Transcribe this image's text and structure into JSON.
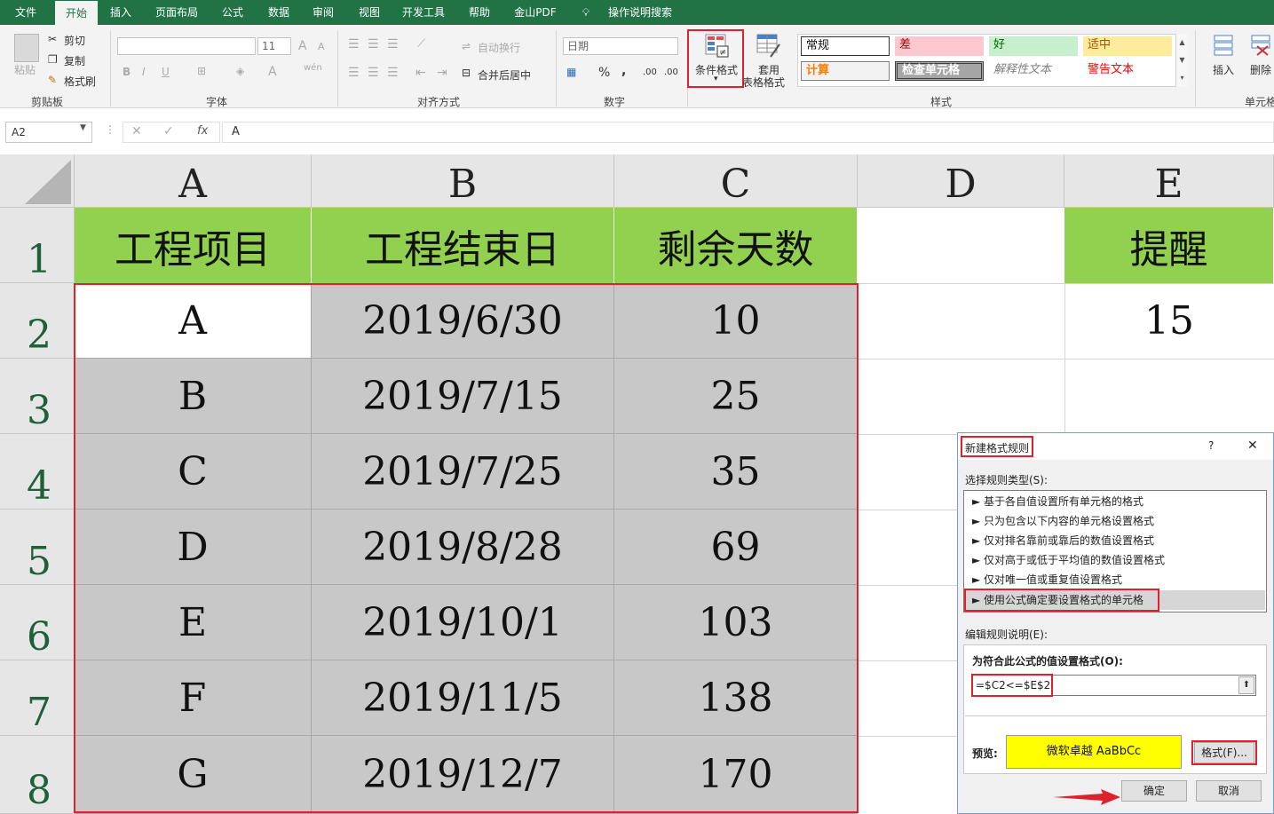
{
  "menu": {
    "items": [
      "文件",
      "开始",
      "插入",
      "页面布局",
      "公式",
      "数据",
      "审阅",
      "视图",
      "开发工具",
      "帮助",
      "金山PDF",
      "操作说明搜索"
    ],
    "active": "开始"
  },
  "ribbon": {
    "clipboard": {
      "paste": "粘贴",
      "cut": "剪切",
      "copy": "复制",
      "format_painter": "格式刷",
      "label": "剪贴板"
    },
    "font": {
      "font_size": "11",
      "bold": "B",
      "italic": "I",
      "underline": "U",
      "label": "字体",
      "grow": "A",
      "shrink": "A",
      "color_a": "A",
      "wen": "wén"
    },
    "alignment": {
      "wrap": "自动换行",
      "merge": "合并后居中",
      "label": "对齐方式"
    },
    "number": {
      "format": "日期",
      "percent": "%",
      "comma": ",",
      "inc_dec": ".00",
      "label": "数字"
    },
    "styles": {
      "conditional": "条件格式",
      "table_format_1": "套用",
      "table_format_2": "表格格式",
      "normal": "常规",
      "bad": "差",
      "good": "好",
      "neutral": "适中",
      "calc": "计算",
      "check": "检查单元格",
      "explain": "解释性文本",
      "warn": "警告文本",
      "label": "样式"
    },
    "cells": {
      "insert": "插入",
      "delete": "删除",
      "label": "单元格"
    }
  },
  "formula_bar": {
    "name_box": "A2",
    "fx": "fx",
    "value": "A"
  },
  "sheet": {
    "columns": [
      "A",
      "B",
      "C",
      "D",
      "E"
    ],
    "rows": [
      "1",
      "2",
      "3",
      "4",
      "5",
      "6",
      "7",
      "8"
    ],
    "headers": [
      "工程项目",
      "工程结束日",
      "剩余天数"
    ],
    "reminder_header": "提醒",
    "reminder_value": "15",
    "data": [
      [
        "A",
        "2019/6/30",
        "10"
      ],
      [
        "B",
        "2019/7/15",
        "25"
      ],
      [
        "C",
        "2019/7/25",
        "35"
      ],
      [
        "D",
        "2019/8/28",
        "69"
      ],
      [
        "E",
        "2019/10/1",
        "103"
      ],
      [
        "F",
        "2019/11/5",
        "138"
      ],
      [
        "G",
        "2019/12/7",
        "170"
      ]
    ]
  },
  "dialog": {
    "title": "新建格式规则",
    "help": "?",
    "close": "✕",
    "rule_type_label": "选择规则类型(S):",
    "rules": [
      "► 基于各自值设置所有单元格的格式",
      "► 只为包含以下内容的单元格设置格式",
      "► 仅对排名靠前或靠后的数值设置格式",
      "► 仅对高于或低于平均值的数值设置格式",
      "► 仅对唯一值或重复值设置格式",
      "► 使用公式确定要设置格式的单元格"
    ],
    "edit_label": "编辑规则说明(E):",
    "formula_label": "为符合此公式的值设置格式(O):",
    "formula": "=$C2<=$E$2",
    "preview_label": "预览:",
    "preview_text": "微软卓越  AaBbCc",
    "format_button": "格式(F)...",
    "ok_button": "确定",
    "cancel_button": "取消"
  },
  "colors": {
    "accent": "#217346",
    "highlight": "#e0202a",
    "header_green": "#92d050",
    "gray_fill": "#c8c8c8",
    "preview_yellow": "#ffff00"
  }
}
